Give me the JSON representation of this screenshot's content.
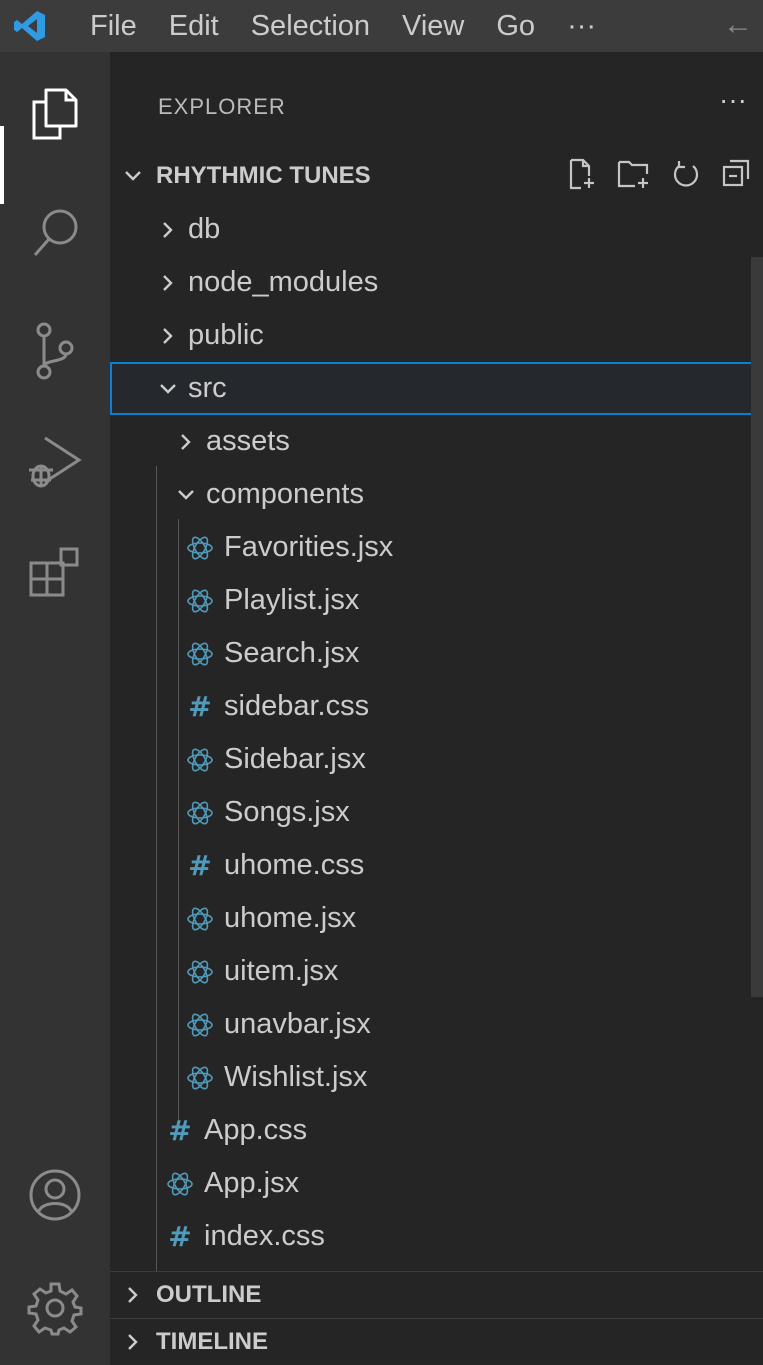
{
  "menu": [
    "File",
    "Edit",
    "Selection",
    "View",
    "Go",
    "···"
  ],
  "explorer": {
    "title": "EXPLORER",
    "more": "···",
    "project": "RHYTHMIC TUNES"
  },
  "tree": [
    {
      "label": "db",
      "type": "folder",
      "open": false,
      "depth": 1
    },
    {
      "label": "node_modules",
      "type": "folder",
      "open": false,
      "depth": 1
    },
    {
      "label": "public",
      "type": "folder",
      "open": false,
      "depth": 1
    },
    {
      "label": "src",
      "type": "folder",
      "open": true,
      "depth": 1,
      "selected": true
    },
    {
      "label": "assets",
      "type": "folder",
      "open": false,
      "depth": 2
    },
    {
      "label": "components",
      "type": "folder",
      "open": true,
      "depth": 2
    },
    {
      "label": "Favorities.jsx",
      "type": "jsx",
      "depth": 3
    },
    {
      "label": "Playlist.jsx",
      "type": "jsx",
      "depth": 3
    },
    {
      "label": "Search.jsx",
      "type": "jsx",
      "depth": 3
    },
    {
      "label": "sidebar.css",
      "type": "css",
      "depth": 3
    },
    {
      "label": "Sidebar.jsx",
      "type": "jsx",
      "depth": 3
    },
    {
      "label": "Songs.jsx",
      "type": "jsx",
      "depth": 3
    },
    {
      "label": "uhome.css",
      "type": "css",
      "depth": 3
    },
    {
      "label": "uhome.jsx",
      "type": "jsx",
      "depth": 3
    },
    {
      "label": "uitem.jsx",
      "type": "jsx",
      "depth": 3
    },
    {
      "label": "unavbar.jsx",
      "type": "jsx",
      "depth": 3
    },
    {
      "label": "Wishlist.jsx",
      "type": "jsx",
      "depth": 3
    },
    {
      "label": "App.css",
      "type": "css",
      "depth": 2
    },
    {
      "label": "App.jsx",
      "type": "jsx",
      "depth": 2
    },
    {
      "label": "index.css",
      "type": "css",
      "depth": 2
    }
  ],
  "sections": {
    "outline": "OUTLINE",
    "timeline": "TIMELINE"
  },
  "colors": {
    "accent": "#0a7fd4",
    "icon_blue": "#519aba"
  }
}
